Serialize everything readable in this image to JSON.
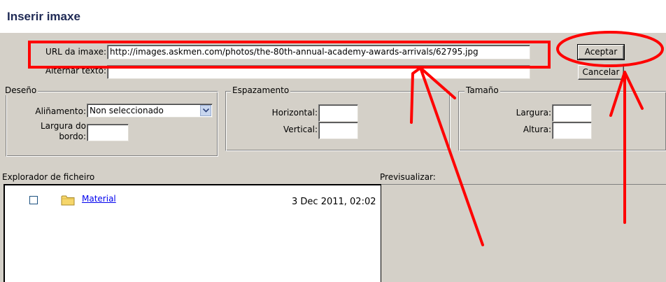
{
  "dialog": {
    "title": "Inserir imaxe"
  },
  "url": {
    "label": "URL da imaxe:",
    "value": "http://images.askmen.com/photos/the-80th-annual-academy-awards-arrivals/62795.jpg"
  },
  "alt_text": {
    "label": "Alternar texto:",
    "value": ""
  },
  "buttons": {
    "accept": "Aceptar",
    "cancel": "Cancelar"
  },
  "design": {
    "legend": "Deseño",
    "alignment_label": "Aliñamento:",
    "alignment_value": "Non seleccionado",
    "border_label_line1": "Largura do",
    "border_label_line2": "bordo:",
    "border_value": ""
  },
  "spacing": {
    "legend": "Espazamento",
    "horizontal_label": "Horizontal:",
    "horizontal_value": "",
    "vertical_label": "Vertical:",
    "vertical_value": ""
  },
  "size": {
    "legend": "Tamaño",
    "width_label": "Largura:",
    "width_value": "",
    "height_label": "Altura:",
    "height_value": ""
  },
  "file_browser": {
    "label": "Explorador de ficheiro",
    "items": [
      {
        "name": "Material",
        "date": "3 Dec 2011, 02:02",
        "icon": "folder-icon",
        "checked": false
      }
    ]
  },
  "preview": {
    "label": "Previsualizar:"
  },
  "colors": {
    "title_text": "#1f2a55",
    "dialog_background": "#d4d0c8",
    "annotation_red": "#ff0000",
    "folder_yellow": "#f6d66a",
    "link_blue": "#0000ee"
  }
}
